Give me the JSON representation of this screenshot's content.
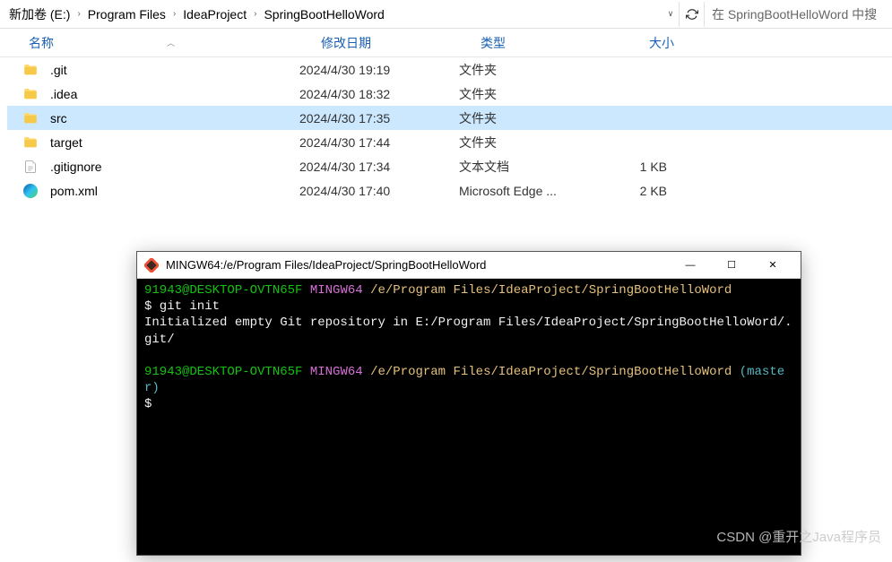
{
  "breadcrumb": {
    "items": [
      "新加卷 (E:)",
      "Program Files",
      "IdeaProject",
      "SpringBootHelloWord"
    ]
  },
  "search": {
    "placeholder": "在 SpringBootHelloWord 中搜"
  },
  "columns": {
    "name": "名称",
    "date": "修改日期",
    "type": "类型",
    "size": "大小"
  },
  "files": [
    {
      "icon": "folder",
      "name": ".git",
      "date": "2024/4/30 19:19",
      "type": "文件夹",
      "size": "",
      "selected": false
    },
    {
      "icon": "folder",
      "name": ".idea",
      "date": "2024/4/30 18:32",
      "type": "文件夹",
      "size": "",
      "selected": false
    },
    {
      "icon": "folder",
      "name": "src",
      "date": "2024/4/30 17:35",
      "type": "文件夹",
      "size": "",
      "selected": true
    },
    {
      "icon": "folder",
      "name": "target",
      "date": "2024/4/30 17:44",
      "type": "文件夹",
      "size": "",
      "selected": false
    },
    {
      "icon": "file",
      "name": ".gitignore",
      "date": "2024/4/30 17:34",
      "type": "文本文档",
      "size": "1 KB",
      "selected": false
    },
    {
      "icon": "edge",
      "name": "pom.xml",
      "date": "2024/4/30 17:40",
      "type": "Microsoft Edge ...",
      "size": "2 KB",
      "selected": false
    }
  ],
  "terminal": {
    "title": "MINGW64:/e/Program Files/IdeaProject/SpringBootHelloWord",
    "lines": [
      {
        "segments": [
          {
            "class": "c-green",
            "text": "91943@DESKTOP-OVTN65F"
          },
          {
            "class": "c-white",
            "text": " "
          },
          {
            "class": "c-purple",
            "text": "MINGW64"
          },
          {
            "class": "c-white",
            "text": " "
          },
          {
            "class": "c-yellow",
            "text": "/e/Program Files/IdeaProject/SpringBootHelloWord"
          }
        ]
      },
      {
        "segments": [
          {
            "class": "c-white",
            "text": "$ git init"
          }
        ]
      },
      {
        "segments": [
          {
            "class": "c-white",
            "text": "Initialized empty Git repository in E:/Program Files/IdeaProject/SpringBootHelloWord/.git/"
          }
        ]
      },
      {
        "segments": [
          {
            "class": "c-white",
            "text": ""
          }
        ]
      },
      {
        "segments": [
          {
            "class": "c-green",
            "text": "91943@DESKTOP-OVTN65F"
          },
          {
            "class": "c-white",
            "text": " "
          },
          {
            "class": "c-purple",
            "text": "MINGW64"
          },
          {
            "class": "c-white",
            "text": " "
          },
          {
            "class": "c-yellow",
            "text": "/e/Program Files/IdeaProject/SpringBootHelloWord"
          },
          {
            "class": "c-cyan",
            "text": " (master)"
          }
        ]
      },
      {
        "segments": [
          {
            "class": "c-white",
            "text": "$ "
          }
        ]
      }
    ]
  },
  "watermark": "CSDN @重开之Java程序员"
}
